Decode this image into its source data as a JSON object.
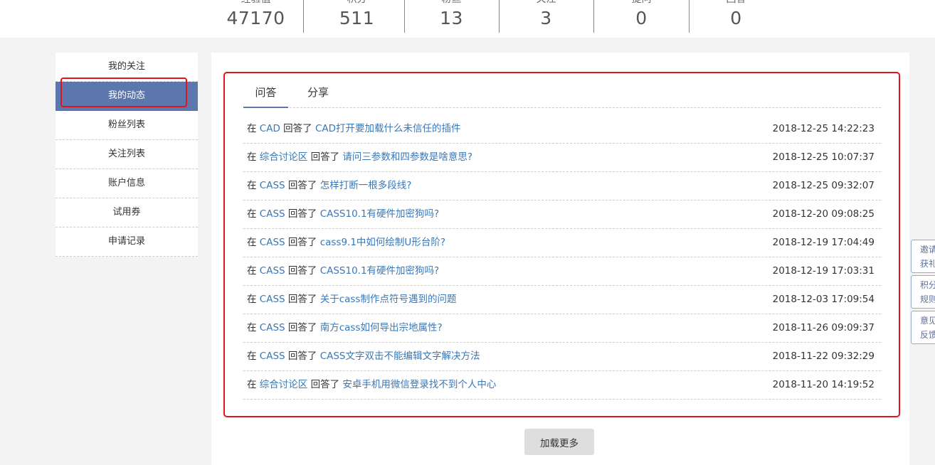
{
  "stats": [
    {
      "label": "经验值",
      "value": "47170"
    },
    {
      "label": "积分",
      "value": "511"
    },
    {
      "label": "粉丝",
      "value": "13"
    },
    {
      "label": "关注",
      "value": "3"
    },
    {
      "label": "提问",
      "value": "0"
    },
    {
      "label": "回答",
      "value": "0"
    }
  ],
  "sidebar": {
    "items": [
      {
        "label": "我的关注"
      },
      {
        "label": "我的动态"
      },
      {
        "label": "粉丝列表"
      },
      {
        "label": "关注列表"
      },
      {
        "label": "账户信息"
      },
      {
        "label": "试用券"
      },
      {
        "label": "申请记录"
      }
    ],
    "active_index": 1
  },
  "tabs": [
    {
      "label": "问答"
    },
    {
      "label": "分享"
    }
  ],
  "activity": {
    "prefix": "在",
    "verb": "回答了",
    "rows": [
      {
        "category": "CAD",
        "title": "CAD打开要加载什么未信任的插件",
        "time": "2018-12-25 14:22:23"
      },
      {
        "category": "综合讨论区",
        "title": "请问三参数和四参数是啥意思?",
        "time": "2018-12-25 10:07:37"
      },
      {
        "category": "CASS",
        "title": "怎样打断一根多段线?",
        "time": "2018-12-25 09:32:07"
      },
      {
        "category": "CASS",
        "title": "CASS10.1有硬件加密狗吗?",
        "time": "2018-12-20 09:08:25"
      },
      {
        "category": "CASS",
        "title": "cass9.1中如何绘制U形台阶?",
        "time": "2018-12-19 17:04:49"
      },
      {
        "category": "CASS",
        "title": "CASS10.1有硬件加密狗吗?",
        "time": "2018-12-19 17:03:31"
      },
      {
        "category": "CASS",
        "title": "关于cass制作点符号遇到的问题",
        "time": "2018-12-03 17:09:54"
      },
      {
        "category": "CASS",
        "title": "南方cass如何导出宗地属性?",
        "time": "2018-11-26 09:09:37"
      },
      {
        "category": "CASS",
        "title": "CASS文字双击不能编辑文字解决方法",
        "time": "2018-11-22 09:32:29"
      },
      {
        "category": "综合讨论区",
        "title": "安卓手机用微信登录找不到个人中心",
        "time": "2018-11-20 14:19:52"
      }
    ]
  },
  "load_more_label": "加载更多",
  "float_buttons": [
    {
      "line1": "邀请",
      "line2": "获礼"
    },
    {
      "line1": "积分",
      "line2": "规则"
    },
    {
      "line1": "意见",
      "line2": "反馈"
    }
  ],
  "colors": {
    "accent": "#5c77ad",
    "link": "#3a77b5",
    "highlight": "#e3121b"
  }
}
